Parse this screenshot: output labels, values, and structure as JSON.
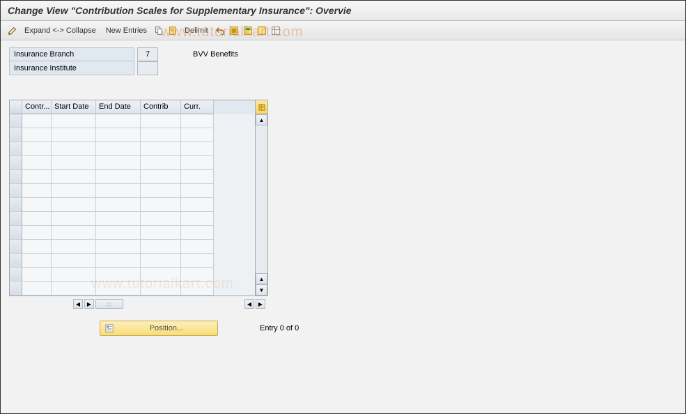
{
  "title": "Change View \"Contribution Scales for Supplementary Insurance\": Overvie",
  "toolbar": {
    "expand_collapse": "Expand <-> Collapse",
    "new_entries": "New Entries",
    "delimit": "Delimit"
  },
  "fields": {
    "branch_label": "Insurance Branch",
    "branch_value": "7",
    "branch_desc": "BVV Benefits",
    "institute_label": "Insurance Institute",
    "institute_value": ""
  },
  "table": {
    "columns": {
      "contr": "Contr...",
      "start": "Start Date",
      "end": "End Date",
      "contrib": "Contrib",
      "curr": "Curr."
    },
    "rows": [
      {},
      {},
      {},
      {},
      {},
      {},
      {},
      {},
      {},
      {},
      {},
      {},
      {}
    ]
  },
  "footer": {
    "position": "Position...",
    "entry": "Entry 0 of 0"
  },
  "watermark": "www.tutorialkart.com"
}
